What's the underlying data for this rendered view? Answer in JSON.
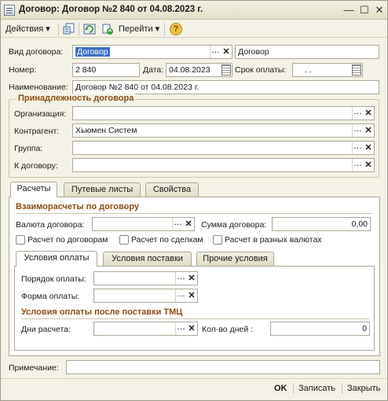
{
  "window": {
    "title": "Договор: Договор №2 840 от 04.08.2023 г.",
    "minimize": "—",
    "maximize": "☐",
    "close": "✕"
  },
  "toolbar": {
    "actions_label": "Действия ▾",
    "goto_label": "Перейти ▾",
    "help_label": "?"
  },
  "header": {
    "contract_type_label": "Вид договора:",
    "contract_type_value": "Договор",
    "contract_type_text": "Договор",
    "number_label": "Номер:",
    "number_value": "2 840",
    "date_label": "Дата:",
    "date_value": "04.08.2023",
    "due_label": "Срок оплаты:",
    "due_value": ". .",
    "name_label": "Наименование:",
    "name_value": "Договор №2 840 от 04.08.2023 г."
  },
  "belonging": {
    "title": "Принадлежность договора",
    "org_label": "Организация:",
    "org_value": "",
    "counterparty_label": "Контрагент:",
    "counterparty_value": "Хьюмен Систем",
    "group_label": "Группа:",
    "group_value": "",
    "to_contract_label": "К договору:",
    "to_contract_value": ""
  },
  "tabs": [
    "Расчеты",
    "Путевые листы",
    "Свойства"
  ],
  "settlements": {
    "title": "Взаиморасчеты по договору",
    "currency_label": "Валюта договора:",
    "currency_value": "",
    "amount_label": "Сумма договора:",
    "amount_value": "0,00",
    "chk_contracts": "Расчет по договорам",
    "chk_deals": "Расчет по сделкам",
    "chk_currencies": "Расчет в разных валютах"
  },
  "subtabs": [
    "Условия оплаты",
    "Условия поставки",
    "Прочие условия"
  ],
  "payment": {
    "order_label": "Порядок оплаты:",
    "order_value": "",
    "form_label": "Форма оплаты:",
    "form_value": "",
    "after_title": "Условия оплаты после поставки ТМЦ",
    "days_label": "Дни расчета:",
    "days_value": "",
    "count_label": "Кол-во дней :",
    "count_value": "0"
  },
  "note": {
    "label": "Примечание:",
    "value": ""
  },
  "footer": {
    "ok": "OK",
    "save": "Записать",
    "close": "Закрыть"
  },
  "icons": {
    "select": "…",
    "clear": "✕"
  },
  "colors": {
    "window_bg": "#f4f2e6",
    "section_title": "#8a4d17",
    "selection": "#3b6fc6"
  }
}
